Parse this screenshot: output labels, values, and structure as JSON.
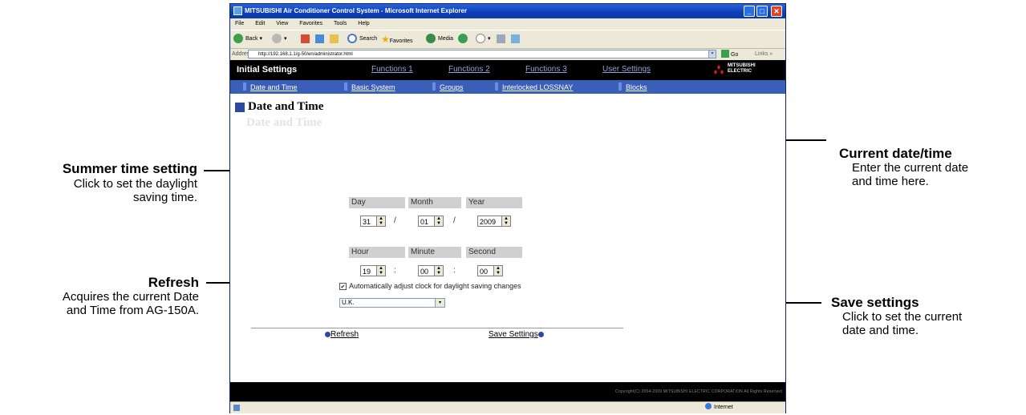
{
  "callouts": {
    "current": {
      "title": "Current date/time",
      "desc1": "Enter the current date",
      "desc2": "and time here."
    },
    "summer": {
      "title": "Summer time setting",
      "desc1": "Click to set the daylight",
      "desc2": "saving time."
    },
    "refresh": {
      "title": "Refresh",
      "desc1": "Acquires the current Date",
      "desc2": "and Time from AG-150A."
    },
    "save": {
      "title": "Save settings",
      "desc1": "Click to set the current",
      "desc2": "date and time."
    }
  },
  "window": {
    "title": "MITSUBISHI Air Conditioner Control System - Microsoft Internet Explorer",
    "menu": [
      "File",
      "Edit",
      "View",
      "Favorites",
      "Tools",
      "Help"
    ],
    "toolbar": {
      "back": "Back",
      "search": "Search",
      "favorites": "Favorites",
      "media": "Media"
    },
    "address_label": "Address",
    "address": "http://192.168.1.1/g-50/en/administrator.html",
    "go": "Go",
    "links": "Links",
    "status_zone": "Internet"
  },
  "app": {
    "header": {
      "section": "Initial Settings",
      "nav": [
        "Functions 1",
        "Functions 2",
        "Functions 3",
        "User Settings"
      ],
      "brand_line1": "MITSUBISHI",
      "brand_line2": "ELECTRIC"
    },
    "subnav": [
      "Date and Time",
      "Basic System",
      "Groups",
      "Interlocked LOSSNAY",
      "Blocks"
    ],
    "page_title": "Date and Time",
    "date": {
      "labels": {
        "day": "Day",
        "month": "Month",
        "year": "Year"
      },
      "values": {
        "day": "31",
        "month": "01",
        "year": "2009"
      },
      "sep": "/"
    },
    "time": {
      "labels": {
        "hour": "Hour",
        "minute": "Minute",
        "second": "Second"
      },
      "values": {
        "hour": "19",
        "minute": "00",
        "second": "00"
      },
      "sep": ":"
    },
    "dst": {
      "checked": true,
      "label": "Automatically adjust clock for daylight saving changes",
      "zone": "U.K."
    },
    "actions": {
      "refresh": "Refresh",
      "save": "Save Settings"
    },
    "copyright": "Copyright(C) 2004-2009 MITSUBISHI ELECTRIC CORPORATION All Rights Reserved"
  },
  "colors": {
    "accent": "#2a4aa0",
    "subnav": "#3a5fb8",
    "header": "#000000"
  }
}
